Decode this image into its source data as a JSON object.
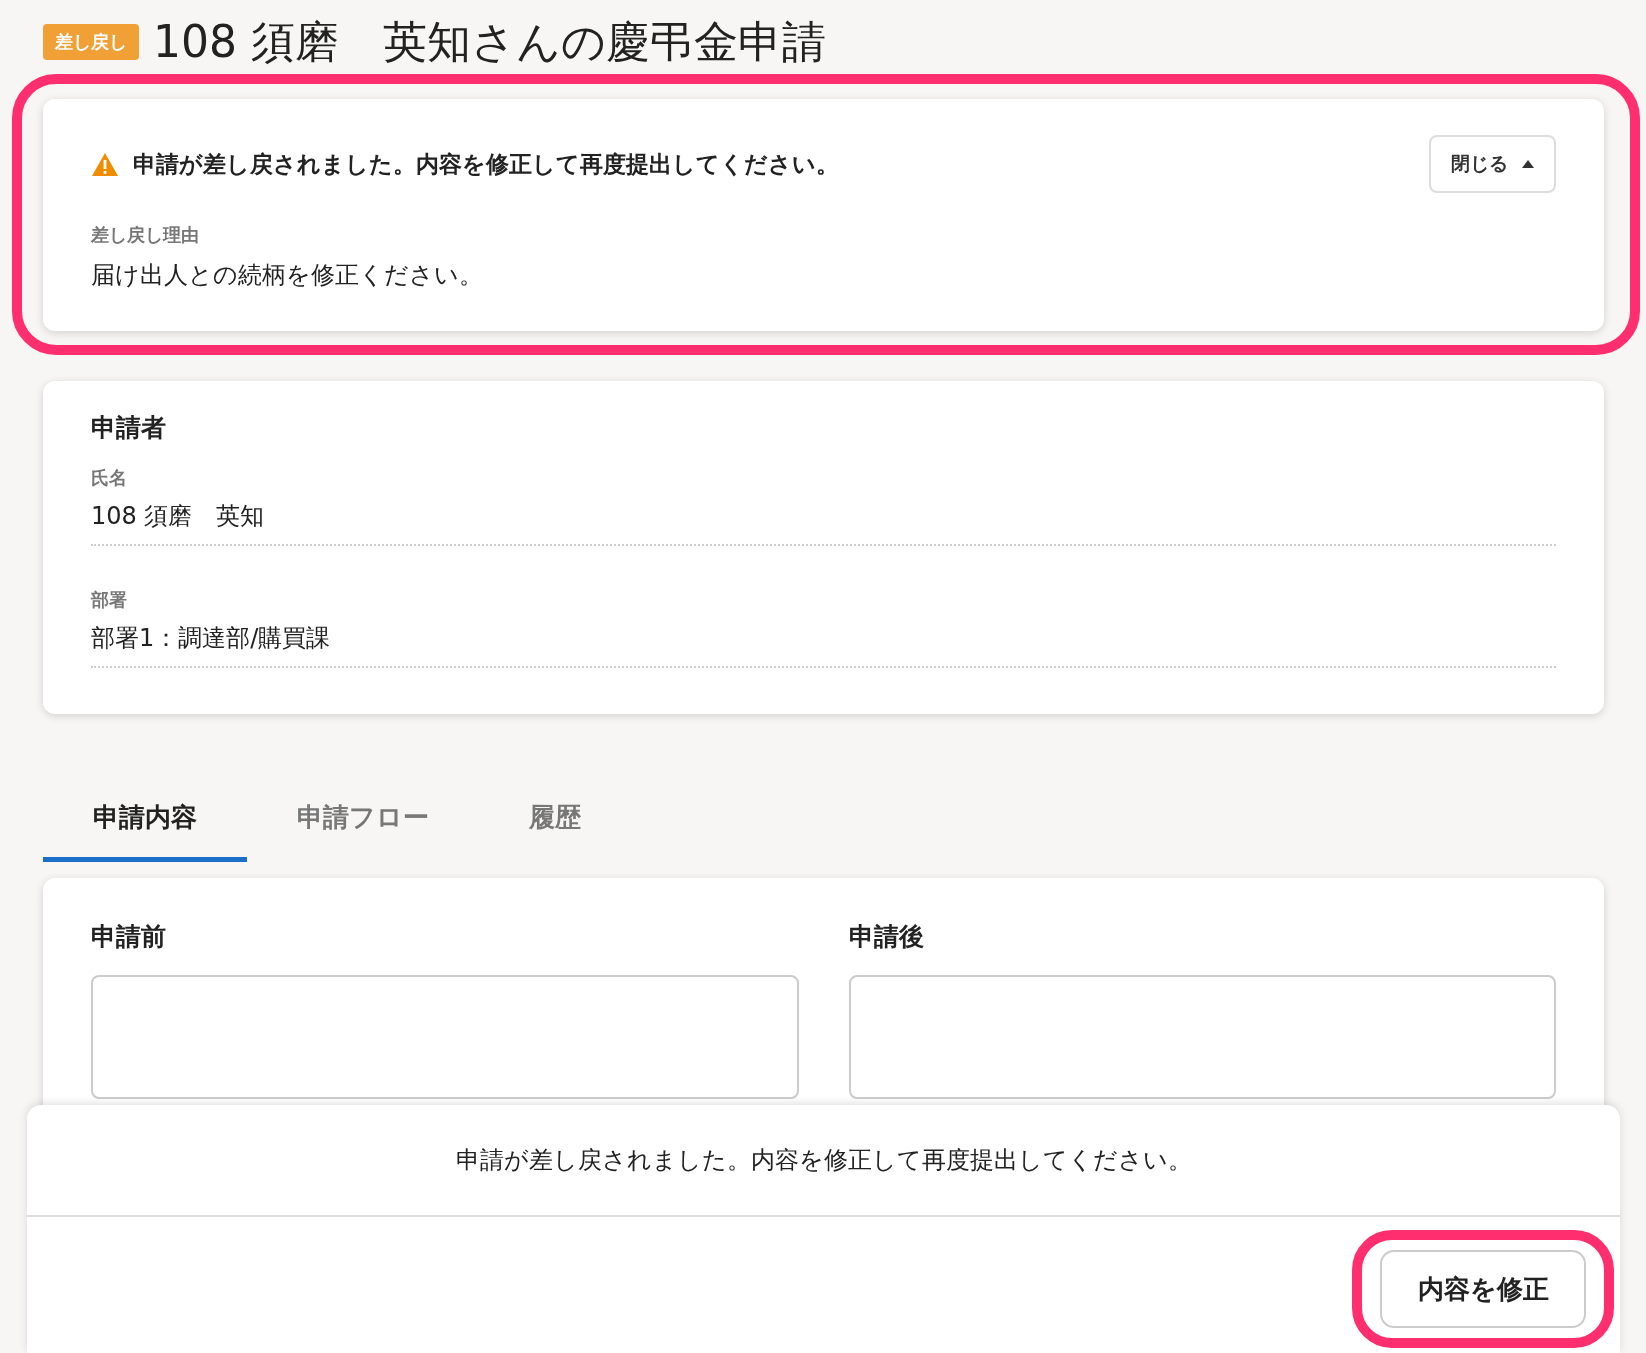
{
  "status_badge": "差し戻し",
  "title": "108 須磨　英知さんの慶弔金申請",
  "alert": {
    "message": "申請が差し戻されました。内容を修正して再度提出してください。",
    "toggle_button": "閉じる",
    "expanded": true,
    "highlighted": true,
    "reason_label": "差し戻し理由",
    "reason": "届け出人との続柄を修正ください。"
  },
  "applicant": {
    "heading": "申請者",
    "fields": [
      {
        "label": "氏名",
        "value": "108 須磨　英知"
      },
      {
        "label": "部署",
        "value": "部署1：調達部/購買課"
      }
    ]
  },
  "tabs": [
    {
      "label": "申請内容",
      "selected": true
    },
    {
      "label": "申請フロー",
      "selected": false
    },
    {
      "label": "履歴",
      "selected": false
    }
  ],
  "content": {
    "columns": [
      {
        "heading": "申請前"
      },
      {
        "heading": "申請後"
      }
    ]
  },
  "footer": {
    "message": "申請が差し戻されました。内容を修正して再度提出してください。",
    "button": "内容を修正",
    "highlighted": true
  }
}
